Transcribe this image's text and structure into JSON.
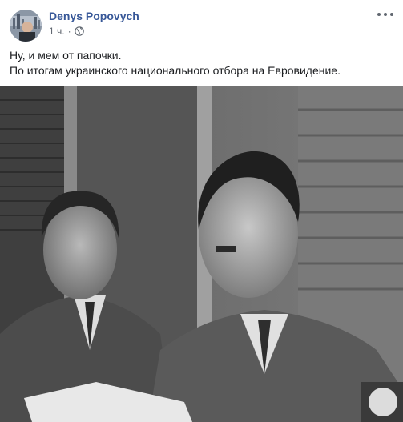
{
  "post": {
    "author": "Denys Popovych",
    "timestamp": "1 ч.",
    "separator": "·",
    "privacy_icon": "globe-icon",
    "more_icon": "more-options-icon",
    "text_lines": [
      "Ну, и мем от папочки.",
      "По итогам украинского национального отбора на Евровидение."
    ],
    "link_color": "#385898"
  }
}
